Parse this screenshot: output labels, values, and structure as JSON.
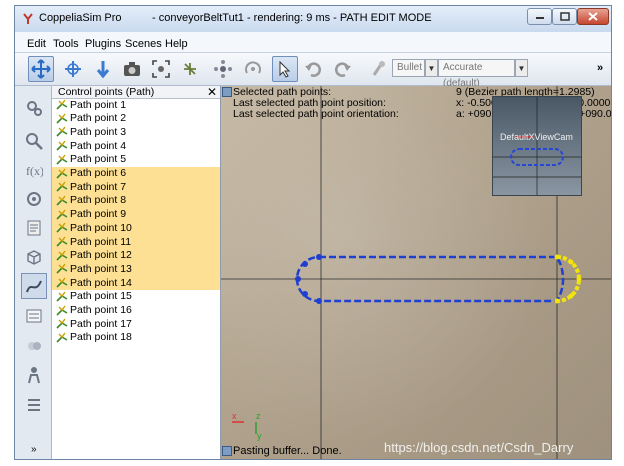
{
  "window": {
    "app_name": "CoppeliaSim Pro",
    "doc_title": "- conveyorBeltTut1 - rendering: 9 ms - PATH EDIT MODE"
  },
  "menu": [
    "Edit",
    "Tools",
    "Plugins",
    "Scenes",
    "Help"
  ],
  "toolbar": {
    "bullet_label": "Bullet",
    "accuracy_label": "Accurate (default)",
    "overflow": "»"
  },
  "tree": {
    "header": "Control points (Path)",
    "close": "✕",
    "items": [
      {
        "label": "Path point 1",
        "selected": false
      },
      {
        "label": "Path point 2",
        "selected": false
      },
      {
        "label": "Path point 3",
        "selected": false
      },
      {
        "label": "Path point 4",
        "selected": false
      },
      {
        "label": "Path point 5",
        "selected": false
      },
      {
        "label": "Path point 6",
        "selected": true
      },
      {
        "label": "Path point 7",
        "selected": true
      },
      {
        "label": "Path point 8",
        "selected": true
      },
      {
        "label": "Path point 9",
        "selected": true
      },
      {
        "label": "Path point 10",
        "selected": true
      },
      {
        "label": "Path point 11",
        "selected": true
      },
      {
        "label": "Path point 12",
        "selected": true
      },
      {
        "label": "Path point 13",
        "selected": true
      },
      {
        "label": "Path point 14",
        "selected": true
      },
      {
        "label": "Path point 15",
        "selected": false
      },
      {
        "label": "Path point 16",
        "selected": false
      },
      {
        "label": "Path point 17",
        "selected": false
      },
      {
        "label": "Path point 18",
        "selected": false
      }
    ]
  },
  "scene": {
    "info_labels": [
      "Selected path points:",
      "Last selected path point position:",
      "Last selected path point orientation:"
    ],
    "info_values": [
      "9 (Bezier path length=1.2985)",
      "x: -0.5000, y: -0.0484, z: +0.0000",
      "a: +090.00, b: +084.37, g: +090.00"
    ],
    "thumb_label": "DefaultXViewCam",
    "axis_x": "x",
    "axis_y": "y",
    "axis_z": "z",
    "status": "Pasting buffer... Done.",
    "watermark": "https://blog.csdn.net/Csdn_Darry"
  },
  "colors": {
    "selection": "#fde093",
    "path_line": "#1e3fd0",
    "path_selected": "#f2e30b",
    "grid": "#2b2b2b"
  }
}
